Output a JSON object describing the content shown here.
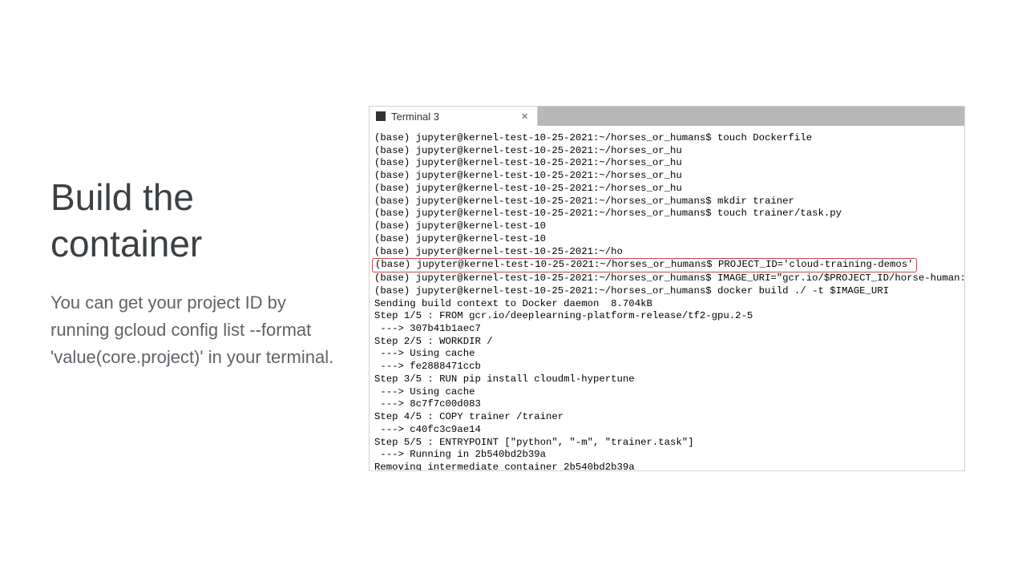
{
  "left": {
    "heading": "Build the container",
    "description": "You can get your project ID by running gcloud config list --format 'value(core.project)' in your terminal."
  },
  "terminal": {
    "tab_title": "Terminal 3",
    "lines": [
      "(base) jupyter@kernel-test-10-25-2021:~/horses_or_humans$ touch Dockerfile",
      "(base) jupyter@kernel-test-10-25-2021:~/horses_or_hu",
      "(base) jupyter@kernel-test-10-25-2021:~/horses_or_hu",
      "(base) jupyter@kernel-test-10-25-2021:~/horses_or_hu",
      "(base) jupyter@kernel-test-10-25-2021:~/horses_or_hu",
      "(base) jupyter@kernel-test-10-25-2021:~/horses_or_humans$ mkdir trainer",
      "(base) jupyter@kernel-test-10-25-2021:~/horses_or_humans$ touch trainer/task.py",
      "(base) jupyter@kernel-test-10",
      "(base) jupyter@kernel-test-10",
      "(base) jupyter@kernel-test-10-25-2021:~/ho",
      "(base) jupyter@kernel-test-10-25-2021:~/horses_or_humans$ PROJECT_ID='cloud-training-demos'",
      "(base) jupyter@kernel-test-10-25-2021:~/horses_or_humans$ IMAGE_URI=\"gcr.io/$PROJECT_ID/horse-human:hypertu",
      "(base) jupyter@kernel-test-10-25-2021:~/horses_or_humans$ docker build ./ -t $IMAGE_URI",
      "Sending build context to Docker daemon  8.704kB",
      "Step 1/5 : FROM gcr.io/deeplearning-platform-release/tf2-gpu.2-5",
      " ---> 307b41b1aec7",
      "Step 2/5 : WORKDIR /",
      " ---> Using cache",
      " ---> fe2888471ccb",
      "Step 3/5 : RUN pip install cloudml-hypertune",
      " ---> Using cache",
      " ---> 8c7f7c00d083",
      "Step 4/5 : COPY trainer /trainer",
      " ---> c40fc3c9ae14",
      "Step 5/5 : ENTRYPOINT [\"python\", \"-m\", \"trainer.task\"]",
      " ---> Running in 2b540bd2b39a",
      "Removing intermediate container 2b540bd2b39a"
    ],
    "highlight_index": 10
  }
}
